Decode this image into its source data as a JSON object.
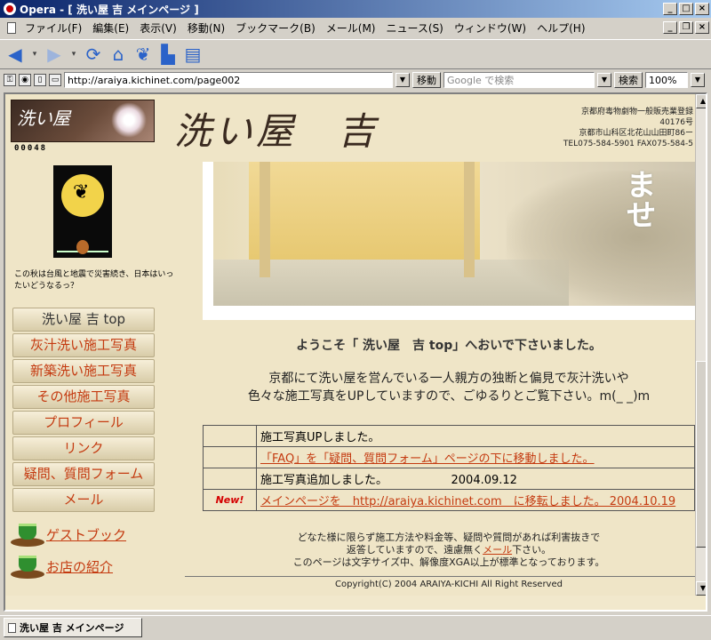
{
  "window": {
    "title": "Opera - [ 洗い屋 吉 メインページ ]"
  },
  "menu": [
    "ファイル(F)",
    "編集(E)",
    "表示(V)",
    "移動(N)",
    "ブックマーク(B)",
    "メール(M)",
    "ニュース(S)",
    "ウィンドウ(W)",
    "ヘルプ(H)"
  ],
  "toolbar": {
    "url": "http://araiya.kichinet.com/page002",
    "go_label": "移動",
    "search_placeholder": "Google で検索",
    "search_button": "検索",
    "zoom": "100%"
  },
  "header": {
    "logo_text": "洗い屋",
    "counter": "00048",
    "brand": "洗い屋　吉",
    "address_lines": [
      "京都府毒物劇物一般販売業登録",
      "40176号",
      "京都市山科区北花山山田町86ー",
      "TEL075-584-5901 FAX075-584-5"
    ]
  },
  "sidebar": {
    "caption": "この秋は台風と地震で災害続き、日本はいったいどうなるっ？",
    "nav": [
      "洗い屋 吉 top",
      "灰汁洗い施工写真",
      "新築洗い施工写真",
      "その他施工写真",
      "プロフィール",
      "リンク",
      "疑問、質問フォーム",
      "メール"
    ],
    "extra_links": [
      "ゲストブック",
      "お店の紹介"
    ]
  },
  "hero": {
    "overlay_text": "ませ"
  },
  "main": {
    "welcome": "ようこそ「 洗い屋　吉 top」へおいで下さいました。",
    "intro_line1": "京都にて洗い屋を営んでいる一人親方の独断と偏見で灰汁洗いや",
    "intro_line2": "色々な施工写真をUPしていますので、ごゆるりとご覧下さい。m(_ _)m",
    "news": [
      {
        "badge": "",
        "text": "施工写真UPしました。",
        "link": false
      },
      {
        "badge": "",
        "text": "「FAQ」を「疑問、質問フォーム」ページの下に移動しました。",
        "link": true
      },
      {
        "badge": "",
        "text": "施工写真追加しました。　　　　　　2004.09.12",
        "link": false
      },
      {
        "badge": "New!",
        "text": "メインページを　http://araiya.kichinet.com　に移転しました。 2004.10.19",
        "link": true
      }
    ],
    "footer_line1": "どなた様に限らず施工方法や料金等、疑問や質問があれば利害抜きで",
    "footer_line2_pre": "返答していますので、遠慮無く",
    "footer_line2_link": "メール",
    "footer_line2_post": "下さい。",
    "footer_line3": "このページは文字サイズ中、解像度XGA以上が標準となっております。",
    "copyright": "Copyright(C) 2004 ARAIYA-KICHI All Right Reserved"
  },
  "tabs": [
    {
      "label": "洗い屋 吉 メインページ"
    }
  ]
}
